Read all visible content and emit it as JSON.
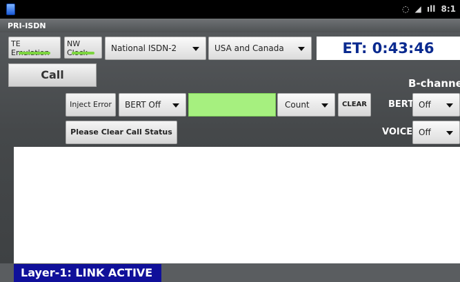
{
  "status_bar": {
    "time": "8:1",
    "signal_text": "ıll"
  },
  "app": {
    "title": "PRI-ISDN"
  },
  "toolbar": {
    "te_emulation": "TE Emulation",
    "nw_clock": "NW Clock",
    "protocol": "National ISDN-2",
    "region": "USA and Canada",
    "elapsed_time": "ET: 0:43:46"
  },
  "call": {
    "label": "Call"
  },
  "controls": {
    "inject_error": "Inject Error",
    "bert": "BERT Off",
    "count": "Count",
    "clear": "CLEAR",
    "clear_call_status": "Please Clear Call Status"
  },
  "b_channel": {
    "title": "B-channe",
    "bert_label": "BERT",
    "bert_value": "Off",
    "voice_label": "VOICE",
    "voice_value": "Off"
  },
  "log": {
    "text": ""
  },
  "footer": {
    "layer1_status": "Layer-1: LINK ACTIVE"
  },
  "colors": {
    "accent_blue": "#0a2a8f",
    "indicator_green": "#7cd43f",
    "status_bar_green": "#a6f07f",
    "footer_bg": "#10109a"
  }
}
